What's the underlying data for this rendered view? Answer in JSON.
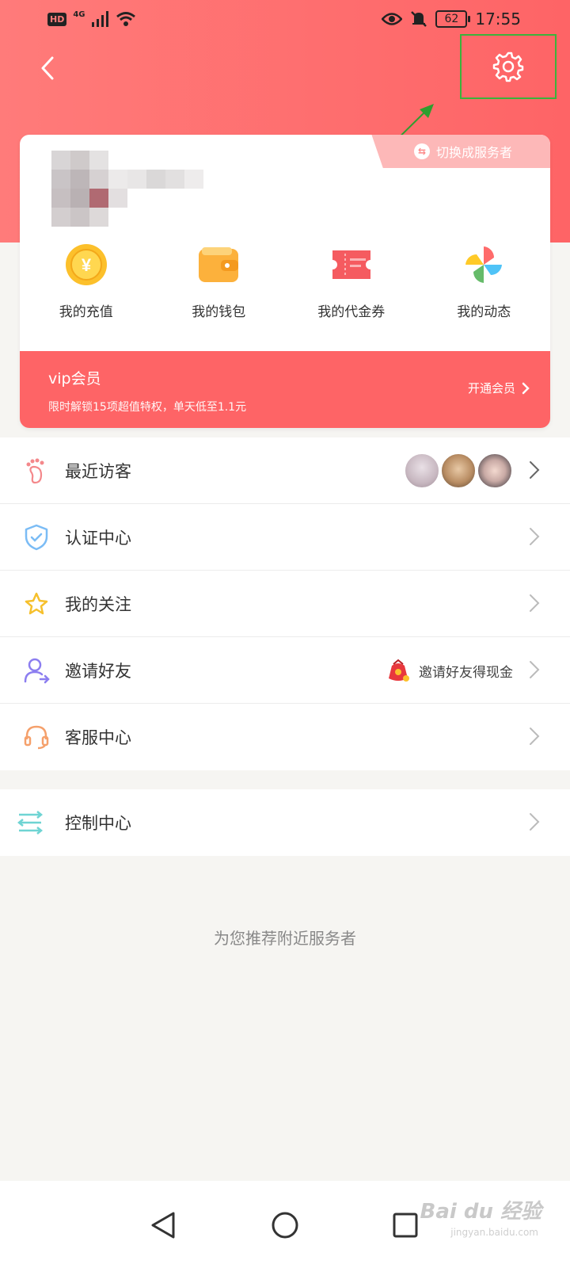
{
  "status_bar": {
    "hd": "HD",
    "network": "4G",
    "battery": "62",
    "time": "17:55"
  },
  "header": {
    "switch_label": "切换成服务者"
  },
  "quick_actions": [
    {
      "label": "我的充值",
      "icon": "yuan-coin-icon"
    },
    {
      "label": "我的钱包",
      "icon": "wallet-icon"
    },
    {
      "label": "我的代金券",
      "icon": "voucher-icon"
    },
    {
      "label": "我的动态",
      "icon": "pinwheel-icon"
    }
  ],
  "vip": {
    "title": "vip会员",
    "desc": "限时解锁15项超值特权，单天低至1.1元",
    "open_label": "开通会员"
  },
  "menu": [
    {
      "label": "最近访客",
      "icon": "footprint-icon"
    },
    {
      "label": "认证中心",
      "icon": "shield-check-icon"
    },
    {
      "label": "我的关注",
      "icon": "star-icon"
    },
    {
      "label": "邀请好友",
      "icon": "user-add-icon",
      "right_text": "邀请好友得现金"
    },
    {
      "label": "客服中心",
      "icon": "headset-icon"
    }
  ],
  "menu2": [
    {
      "label": "控制中心",
      "icon": "sliders-icon"
    }
  ],
  "recommend_label": "为您推荐附近服务者",
  "watermark": {
    "text": "Bai du 经验",
    "sub": "jingyan.baidu.com"
  },
  "colors": {
    "brand": "#fe6466",
    "annotation": "#3bb33b"
  }
}
